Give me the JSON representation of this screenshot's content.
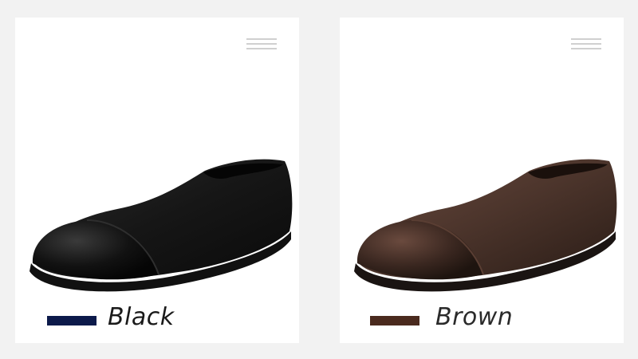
{
  "colors": {
    "page_bg": "#f2f2f2",
    "card_bg": "#ffffff",
    "menu_lines": "#d0d0d0"
  },
  "variants": [
    {
      "label": "Black",
      "swatch_color": "#0c1a4a",
      "shoe_upper": "#161616",
      "shoe_toe": "#0a0a0a",
      "shoe_sole": "#111111",
      "icon": "menu-lines-icon"
    },
    {
      "label": "Brown",
      "swatch_color": "#4a2a1e",
      "shoe_upper": "#4b342b",
      "shoe_toe": "#3a2720",
      "shoe_sole": "#1a1412",
      "icon": "menu-lines-icon"
    }
  ]
}
